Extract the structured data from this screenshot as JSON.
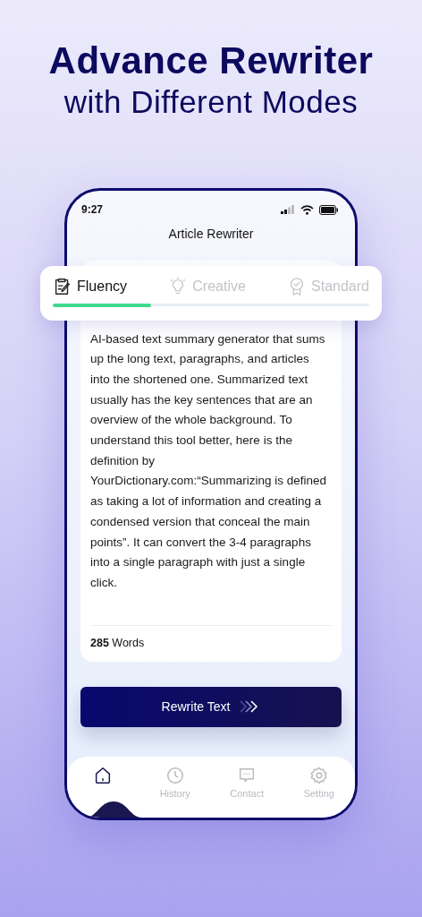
{
  "headline": {
    "title": "Advance Rewriter",
    "subtitle": "with Different Modes"
  },
  "status_bar": {
    "time": "9:27"
  },
  "screen_title": "Article Rewriter",
  "mode_tabs": [
    {
      "label": "Fluency",
      "kind": "note",
      "selected": true
    },
    {
      "label": "Creative",
      "kind": "bulb",
      "selected": false
    },
    {
      "label": "Standard",
      "kind": "badge",
      "selected": false
    }
  ],
  "mode_progress": {
    "level": 0.31
  },
  "article": {
    "text": "AI-based text summary generator that sums up the long text, paragraphs, and articles into the shortened one. Summarized text usually has the key sentences that are an overview of the whole background. To understand this tool better, here is the definition by YourDictionary.com:“Summarizing is defined as taking a lot of information and creating a condensed version that conceal the main points”. It can convert the 3-4 paragraphs into a single paragraph with just a single click.",
    "word_count": "**285** Words"
  },
  "rewrite_button": {
    "label": "Rewrite Text"
  },
  "nav": [
    {
      "kind": "home",
      "selected": true
    },
    {
      "kind": "clock",
      "label": "History",
      "selected": false
    },
    {
      "kind": "chat",
      "label": "Contact",
      "selected": false
    },
    {
      "kind": "gear",
      "label": "Setting",
      "selected": false
    }
  ]
}
